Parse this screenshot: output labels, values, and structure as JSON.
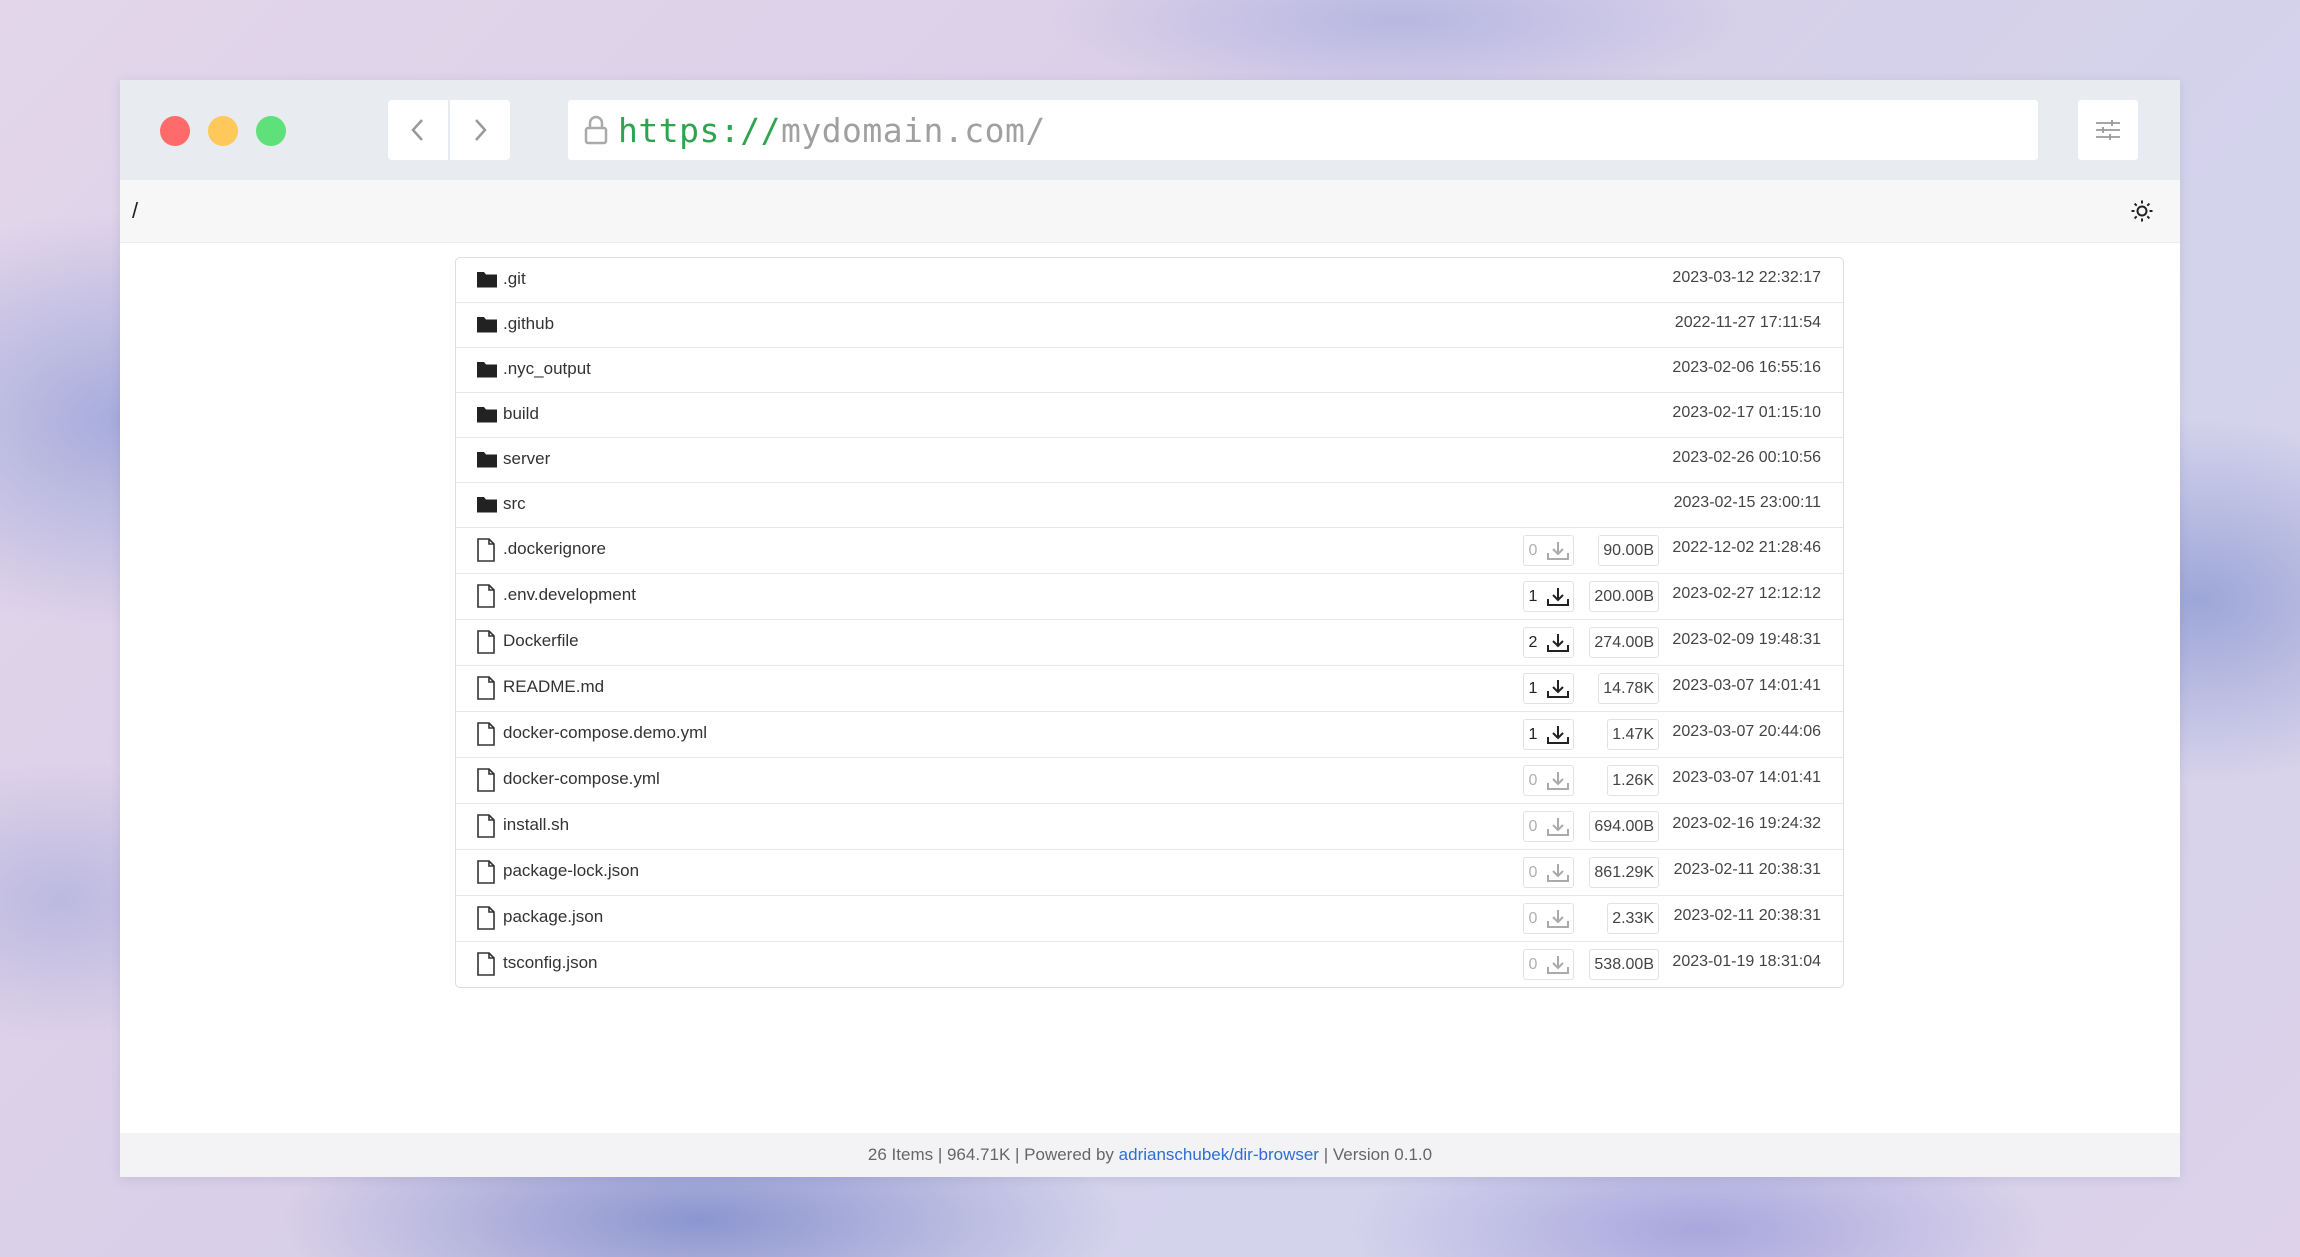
{
  "browser": {
    "url_protocol": "https://",
    "url_host": "mydomain.com/"
  },
  "path": "/",
  "entries": [
    {
      "type": "folder",
      "name": ".git",
      "date": "2023-03-12 22:32:17"
    },
    {
      "type": "folder",
      "name": ".github",
      "date": "2022-11-27 17:11:54"
    },
    {
      "type": "folder",
      "name": ".nyc_output",
      "date": "2023-02-06 16:55:16"
    },
    {
      "type": "folder",
      "name": "build",
      "date": "2023-02-17 01:15:10"
    },
    {
      "type": "folder",
      "name": "server",
      "date": "2023-02-26 00:10:56"
    },
    {
      "type": "folder",
      "name": "src",
      "date": "2023-02-15 23:00:11"
    },
    {
      "type": "file",
      "name": ".dockerignore",
      "downloads": "0",
      "size": "90.00B",
      "date": "2022-12-02 21:28:46"
    },
    {
      "type": "file",
      "name": ".env.development",
      "downloads": "1",
      "size": "200.00B",
      "date": "2023-02-27 12:12:12"
    },
    {
      "type": "file",
      "name": "Dockerfile",
      "downloads": "2",
      "size": "274.00B",
      "date": "2023-02-09 19:48:31"
    },
    {
      "type": "file",
      "name": "README.md",
      "downloads": "1",
      "size": "14.78K",
      "date": "2023-03-07 14:01:41"
    },
    {
      "type": "file",
      "name": "docker-compose.demo.yml",
      "downloads": "1",
      "size": "1.47K",
      "date": "2023-03-07 20:44:06"
    },
    {
      "type": "file",
      "name": "docker-compose.yml",
      "downloads": "0",
      "size": "1.26K",
      "date": "2023-03-07 14:01:41"
    },
    {
      "type": "file",
      "name": "install.sh",
      "downloads": "0",
      "size": "694.00B",
      "date": "2023-02-16 19:24:32"
    },
    {
      "type": "file",
      "name": "package-lock.json",
      "downloads": "0",
      "size": "861.29K",
      "date": "2023-02-11 20:38:31"
    },
    {
      "type": "file",
      "name": "package.json",
      "downloads": "0",
      "size": "2.33K",
      "date": "2023-02-11 20:38:31"
    },
    {
      "type": "file",
      "name": "tsconfig.json",
      "downloads": "0",
      "size": "538.00B",
      "date": "2023-01-19 18:31:04"
    }
  ],
  "footer": {
    "stats": "26 Items | 964.71K | Powered by ",
    "link_text": "adrianschubek/dir-browser",
    "version": " | Version 0.1.0"
  },
  "colors": {
    "traffic_red": "#ff6b6b",
    "traffic_yellow": "#ffc85a",
    "traffic_green": "#5ee07a",
    "url_protocol": "#2ea44f",
    "url_host": "#a0a0a0",
    "link": "#2f6ed3",
    "count_active": "#222222",
    "count_zero": "#b0b0b0"
  },
  "icons": {
    "folder": "folder-icon",
    "file": "file-icon",
    "download": "download-icon",
    "lock": "lock-icon",
    "back": "chevron-left-icon",
    "forward": "chevron-right-icon",
    "settings": "sliders-icon",
    "theme": "sun-icon"
  }
}
